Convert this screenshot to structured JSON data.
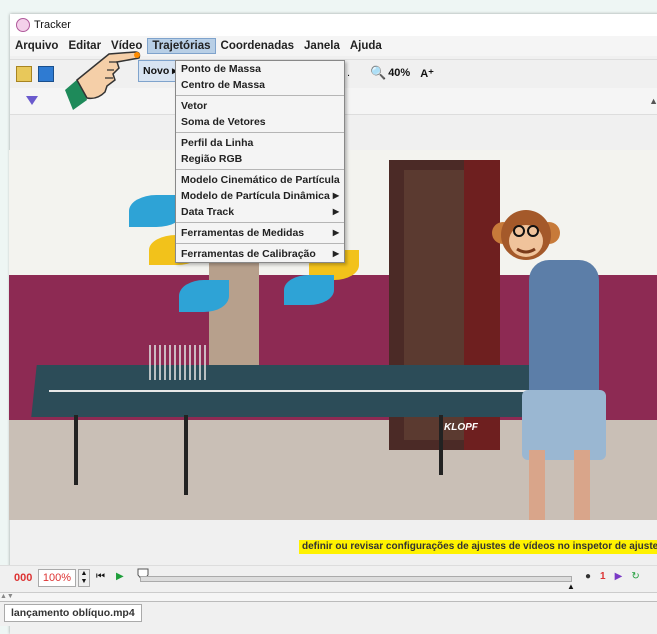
{
  "window": {
    "title": "Tracker"
  },
  "menubar": {
    "items": [
      "Arquivo",
      "Editar",
      "Vídeo",
      "Trajetórias",
      "Coordenadas",
      "Janela",
      "Ajuda"
    ],
    "active_index": 3
  },
  "toolbar": {
    "zoom_label": "40%",
    "zoom_icon": "magnifier-icon",
    "font_size_icon": "A⁺",
    "dot_label": "."
  },
  "submenu_trigger": {
    "label": "Novo",
    "arrow": "▸"
  },
  "dropdown": {
    "groups": [
      {
        "items": [
          {
            "label": "Ponto de Massa",
            "submenu": false
          },
          {
            "label": "Centro de Massa",
            "submenu": false
          }
        ]
      },
      {
        "items": [
          {
            "label": "Vetor",
            "submenu": false
          },
          {
            "label": "Soma de Vetores",
            "submenu": false
          }
        ]
      },
      {
        "items": [
          {
            "label": "Perfil da Linha",
            "submenu": false
          },
          {
            "label": "Região RGB",
            "submenu": false
          }
        ]
      },
      {
        "items": [
          {
            "label": "Modelo Cinemático de Partícula",
            "submenu": false
          },
          {
            "label": "Modelo de Partícula Dinâmica",
            "submenu": true
          },
          {
            "label": "Data Track",
            "submenu": true
          }
        ]
      },
      {
        "items": [
          {
            "label": "Ferramentas de Medidas",
            "submenu": true
          }
        ]
      },
      {
        "items": [
          {
            "label": "Ferramentas de Calibração",
            "submenu": true
          }
        ]
      }
    ]
  },
  "video": {
    "caption": "definir ou revisar configurações de ajustes de vídeos no inspetor de ajustes",
    "table_brand": "KLOPF"
  },
  "playbar": {
    "frame": "000",
    "speed": "100%",
    "step_right": "1",
    "icons": [
      "step-back-icon",
      "play-icon",
      "slider-knob-icon"
    ]
  },
  "tabs": [
    {
      "label": "lançamento oblíquo.mp4"
    }
  ],
  "colors": {
    "caption_bg": "#fff200",
    "menu_highlight": "#b8cfe6",
    "frame_red": "#dd3333"
  }
}
